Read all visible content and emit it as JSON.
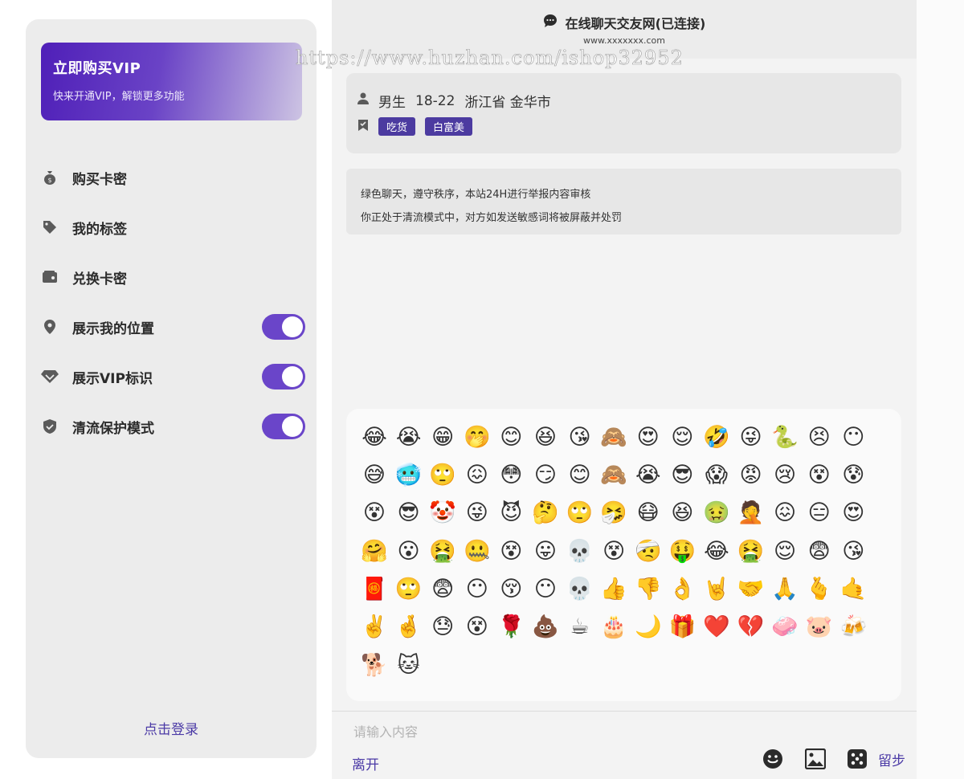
{
  "sidebar": {
    "vip_card": {
      "title": "立即购买VIP",
      "subtitle": "快来开通VIP，解锁更多功能"
    },
    "menu": [
      {
        "label": "购买卡密",
        "icon": "money-bag-icon",
        "toggle": null
      },
      {
        "label": "我的标签",
        "icon": "tag-icon",
        "toggle": null
      },
      {
        "label": "兑换卡密",
        "icon": "wallet-icon",
        "toggle": null
      },
      {
        "label": "展示我的位置",
        "icon": "location-pin-icon",
        "toggle": true
      },
      {
        "label": "展示VIP标识",
        "icon": "diamond-icon",
        "toggle": true
      },
      {
        "label": "清流保护模式",
        "icon": "shield-check-icon",
        "toggle": true
      }
    ],
    "login_label": "点击登录"
  },
  "header": {
    "title": "在线聊天交友网(已连接)",
    "domain": "www.xxxxxxx.com",
    "watermark": "https://www.huzhan.com/ishop32952"
  },
  "profile": {
    "gender": "男生",
    "age": "18-22",
    "location": "浙江省 金华市",
    "tags": [
      "吃货",
      "白富美"
    ]
  },
  "notice": {
    "line1": "绿色聊天，遵守秩序，本站24H进行举报内容审核",
    "line2": "你正处于清流模式中，对方如发送敏感词将被屏蔽并处罚"
  },
  "emoji_panel": {
    "emojis": [
      "😂",
      "😭",
      "😁",
      "🤭",
      "😊",
      "😆",
      "😘",
      "🙈",
      "😍",
      "😌",
      "🤣",
      "😜",
      "🐍",
      "😣",
      "😶",
      "😅",
      "🥶",
      "🙄",
      "😖",
      "😳",
      "😏",
      "😊",
      "🙈",
      "😭",
      "😎",
      "😱",
      "😡",
      "😢",
      "😵",
      "😰",
      "😵",
      "😎",
      "🤡",
      "😜",
      "😈",
      "🤔",
      "🙄",
      "🤧",
      "😷",
      "😆",
      "🤢",
      "🤦",
      "😖",
      "😑",
      "😍",
      "🤗",
      "😮",
      "🤮",
      "🤐",
      "😵",
      "😛",
      "💀",
      "😵",
      "🤕",
      "🤑",
      "😂",
      "🤮",
      "😌",
      "😨",
      "😘",
      "🧧",
      "🙄",
      "😨",
      "😶",
      "😚",
      "😶",
      "💀",
      "👍",
      "👎",
      "👌",
      "🤘",
      "🤝",
      "🙏",
      "🫰",
      "🤙",
      "✌️",
      "🤞",
      "😓",
      "😵",
      "🌹",
      "💩",
      "☕",
      "🎂",
      "🌙",
      "🎁",
      "❤️",
      "💔",
      "🧼",
      "🐷",
      "🍻",
      "🐕",
      "🐱"
    ]
  },
  "composer": {
    "placeholder": "请输入内容",
    "leave_label": "离开",
    "stay_label": "留步"
  },
  "colors": {
    "accent": "#4b3aa6",
    "toggle": "#6a45c9",
    "tag": "#4c3ba0"
  }
}
